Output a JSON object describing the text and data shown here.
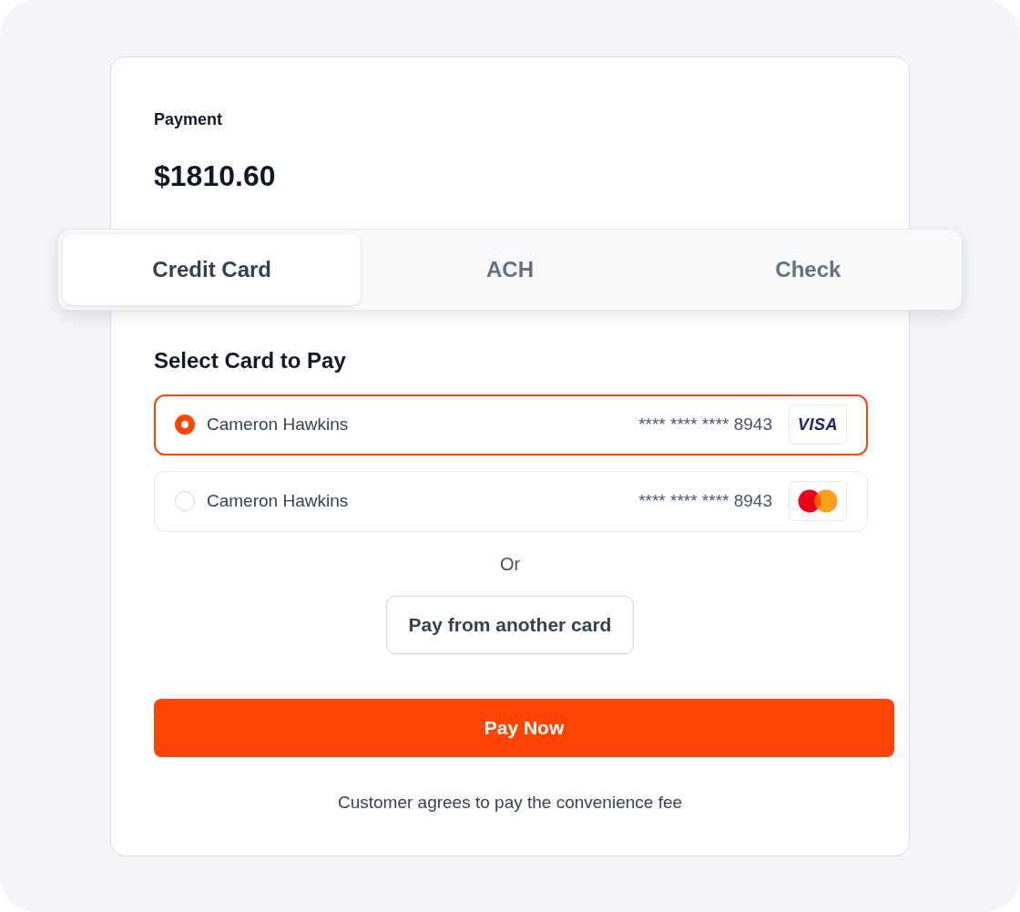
{
  "payment": {
    "title": "Payment",
    "amount": "$1810.60"
  },
  "tabs": [
    {
      "label": "Credit Card",
      "selected": true
    },
    {
      "label": "ACH",
      "selected": false
    },
    {
      "label": "Check",
      "selected": false
    }
  ],
  "card_section": {
    "title": "Select Card to Pay",
    "cards": [
      {
        "name": "Cameron Hawkins",
        "number": "**** **** **** 8943",
        "selected": true,
        "logo": {
          "kind": "visa",
          "text": "VISA"
        }
      },
      {
        "name": "Cameron Hawkins",
        "number": "**** **** **** 8943",
        "selected": false,
        "logo": {
          "kind": "mastercard"
        }
      }
    ]
  },
  "separator": "Or",
  "another_card_button": "Pay from another card",
  "pay_button": "Pay Now",
  "footnote": "Customer agrees to pay the convenience fee"
}
